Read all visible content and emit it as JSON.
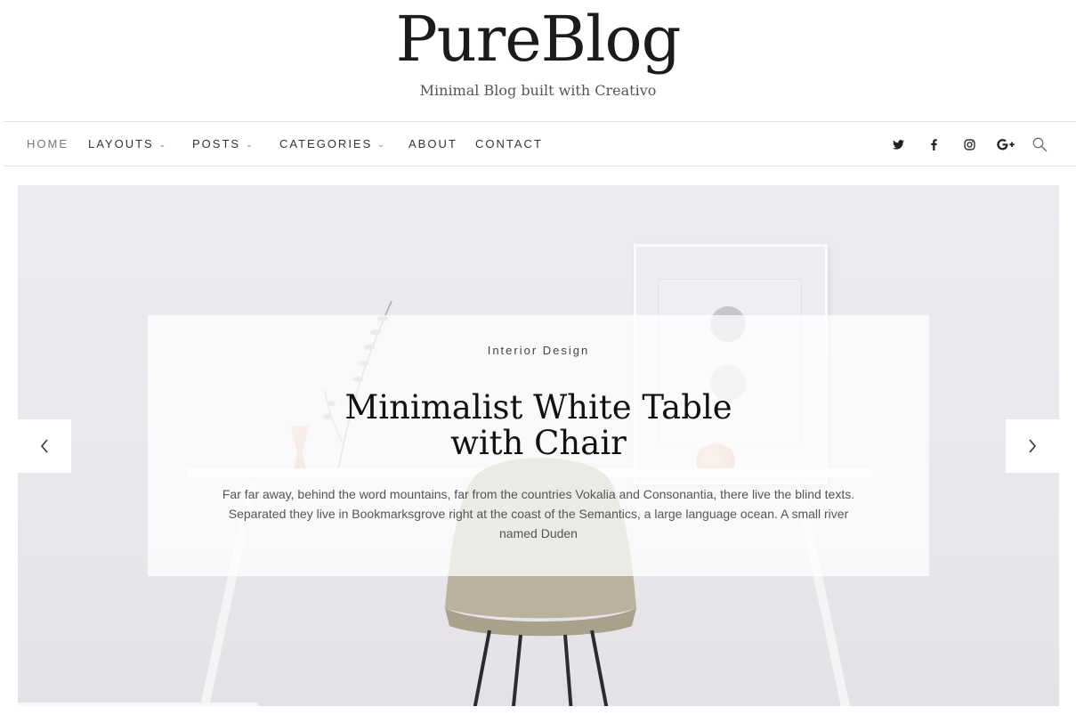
{
  "site": {
    "title": "PureBlog",
    "tagline": "Minimal Blog built with Creativo"
  },
  "nav": {
    "items": [
      {
        "label": "HOME",
        "has_dropdown": false
      },
      {
        "label": "LAYOUTS",
        "has_dropdown": true
      },
      {
        "label": "POSTS",
        "has_dropdown": true
      },
      {
        "label": "CATEGORIES",
        "has_dropdown": true
      },
      {
        "label": "ABOUT",
        "has_dropdown": false
      },
      {
        "label": "CONTACT",
        "has_dropdown": false
      }
    ],
    "dropdown_icon": "chevron-down-icon",
    "social_icons": [
      "twitter-icon",
      "facebook-icon",
      "instagram-icon",
      "google-plus-icon"
    ],
    "search_icon": "search-icon"
  },
  "hero": {
    "category": "Interior Design",
    "title": "Minimalist White Table with Chair",
    "excerpt": "Far far away, behind the word mountains, far from the countries Vokalia and Consonantia, there live the blind texts. Separated they live in Bookmarksgrove right at the coast of the Semantics, a large language ocean. A small river named Duden",
    "prev_icon": "chevron-left-icon",
    "next_icon": "chevron-right-icon"
  },
  "colors": {
    "text_dark": "#1e1a1a",
    "nav_text": "#333333",
    "border": "#e4e4e4",
    "hero_bg": "#ebe9ee"
  }
}
